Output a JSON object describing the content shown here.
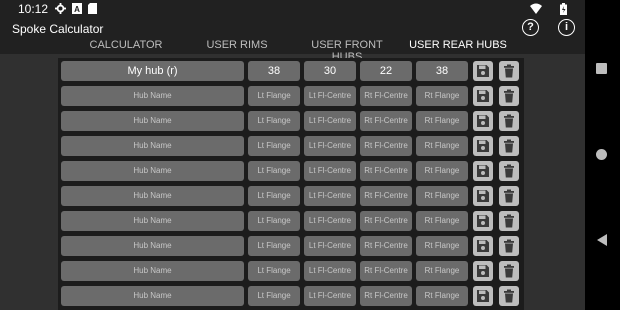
{
  "status": {
    "time": "10:12",
    "icons": [
      "gear-icon",
      "a-badge-icon",
      "sd-card-icon",
      "wifi-icon",
      "battery-icon"
    ]
  },
  "app": {
    "title": "Spoke Calculator",
    "help_icon": "?",
    "info_icon": "i"
  },
  "tabs": [
    {
      "label": "CALCULATOR"
    },
    {
      "label": "USER RIMS"
    },
    {
      "label": "USER FRONT HUBS"
    },
    {
      "label": "USER REAR HUBS"
    }
  ],
  "placeholders": {
    "name": "Hub Name",
    "lt_flange": "Lt Flange",
    "lt_fl_centre": "Lt Fl-Centre",
    "rt_fl_centre": "Rt Fl-Centre",
    "rt_flange": "Rt Flange"
  },
  "hubs": [
    {
      "name": "My hub (r)",
      "lt_flange": "38",
      "lt_fl_centre": "30",
      "rt_fl_centre": "22",
      "rt_flange": "38"
    },
    {
      "name": "",
      "lt_flange": "",
      "lt_fl_centre": "",
      "rt_fl_centre": "",
      "rt_flange": ""
    },
    {
      "name": "",
      "lt_flange": "",
      "lt_fl_centre": "",
      "rt_fl_centre": "",
      "rt_flange": ""
    },
    {
      "name": "",
      "lt_flange": "",
      "lt_fl_centre": "",
      "rt_fl_centre": "",
      "rt_flange": ""
    },
    {
      "name": "",
      "lt_flange": "",
      "lt_fl_centre": "",
      "rt_fl_centre": "",
      "rt_flange": ""
    },
    {
      "name": "",
      "lt_flange": "",
      "lt_fl_centre": "",
      "rt_fl_centre": "",
      "rt_flange": ""
    },
    {
      "name": "",
      "lt_flange": "",
      "lt_fl_centre": "",
      "rt_fl_centre": "",
      "rt_flange": ""
    },
    {
      "name": "",
      "lt_flange": "",
      "lt_fl_centre": "",
      "rt_fl_centre": "",
      "rt_flange": ""
    },
    {
      "name": "",
      "lt_flange": "",
      "lt_fl_centre": "",
      "rt_fl_centre": "",
      "rt_flange": ""
    },
    {
      "name": "",
      "lt_flange": "",
      "lt_fl_centre": "",
      "rt_fl_centre": "",
      "rt_flange": ""
    }
  ],
  "row_buttons": {
    "save_icon": "floppy-disk-icon",
    "delete_icon": "trash-icon"
  }
}
